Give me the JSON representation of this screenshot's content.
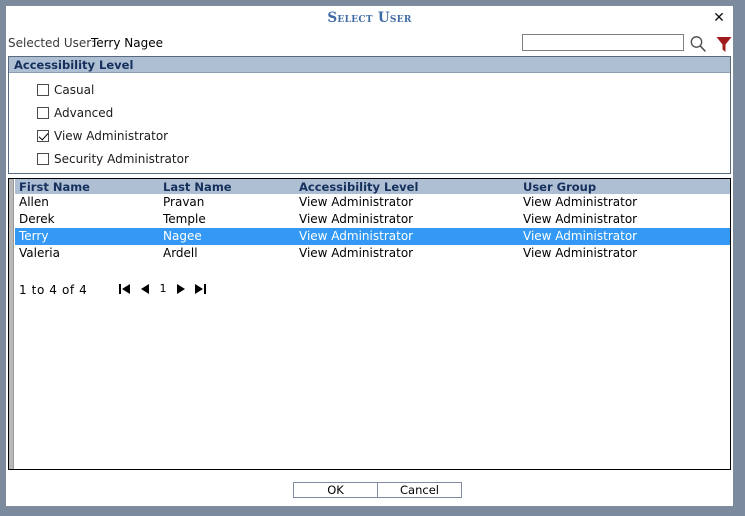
{
  "dialog": {
    "title": "Select User",
    "close_label": "✕",
    "accent_title_color": "#3e6ba5",
    "frame_color": "#7c8a9e",
    "header_band_color": "#aebfd4",
    "selection_color": "#3399f5",
    "filter_icon_color": "#a01c1c"
  },
  "selected_user": {
    "label": "Selected User:",
    "value": "Terry Nagee"
  },
  "search": {
    "value": "",
    "placeholder": "",
    "search_icon": "search-icon",
    "filter_icon": "funnel-filter-icon"
  },
  "accessibility": {
    "header": "Accessibility Level",
    "options": [
      {
        "label": "Casual",
        "checked": false
      },
      {
        "label": "Advanced",
        "checked": false
      },
      {
        "label": "View Administrator",
        "checked": true
      },
      {
        "label": "Security Administrator",
        "checked": false
      }
    ]
  },
  "grid": {
    "columns": [
      "First Name",
      "Last Name",
      "Accessibility Level",
      "User Group"
    ],
    "rows": [
      {
        "cells": [
          "Allen",
          "Pravan",
          "View Administrator",
          "View Administrator"
        ],
        "selected": false
      },
      {
        "cells": [
          "Derek",
          "Temple",
          "View Administrator",
          "View Administrator"
        ],
        "selected": false
      },
      {
        "cells": [
          "Terry",
          "Nagee",
          "View Administrator",
          "View Administrator"
        ],
        "selected": true
      },
      {
        "cells": [
          "Valeria",
          "Ardell",
          "View Administrator",
          "View Administrator"
        ],
        "selected": false
      }
    ]
  },
  "pagination": {
    "range_text": "1  to  4  of  4",
    "current_page": "1",
    "first_icon": "first-page-icon",
    "prev_icon": "previous-page-icon",
    "next_icon": "next-page-icon",
    "last_icon": "last-page-icon"
  },
  "footer": {
    "ok_label": "OK",
    "cancel_label": "Cancel"
  }
}
